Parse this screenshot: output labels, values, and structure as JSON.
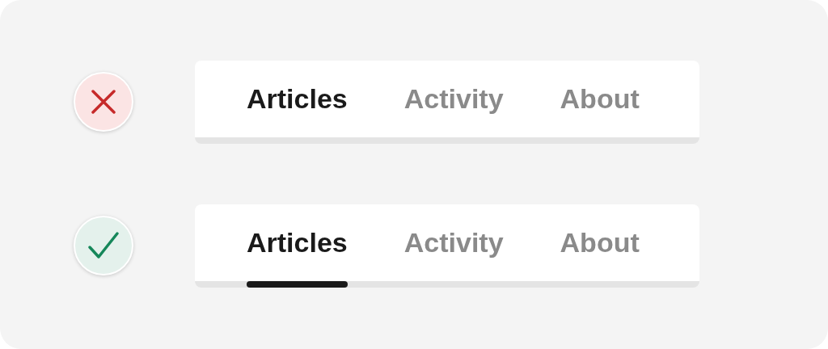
{
  "examples": [
    {
      "kind": "bad",
      "indicator": false,
      "tabs": [
        {
          "label": "Articles",
          "selected": true
        },
        {
          "label": "Activity",
          "selected": false
        },
        {
          "label": "About",
          "selected": false
        }
      ]
    },
    {
      "kind": "good",
      "indicator": true,
      "tabs": [
        {
          "label": "Articles",
          "selected": true
        },
        {
          "label": "Activity",
          "selected": false
        },
        {
          "label": "About",
          "selected": false
        }
      ]
    }
  ]
}
